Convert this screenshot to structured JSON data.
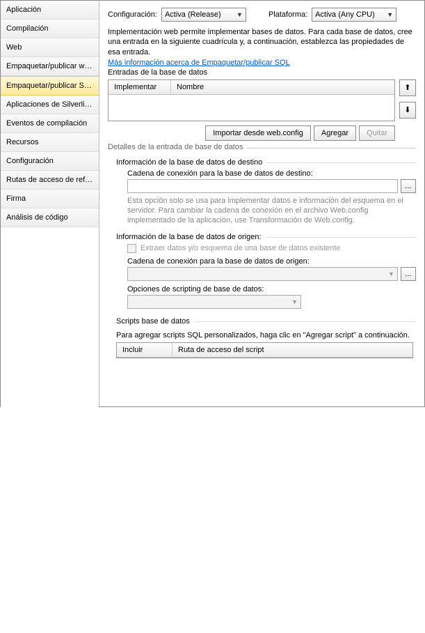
{
  "sidebar": {
    "items": [
      {
        "label": "Aplicación"
      },
      {
        "label": "Compilación"
      },
      {
        "label": "Web"
      },
      {
        "label": "Empaquetar/publicar web*"
      },
      {
        "label": "Empaquetar/publicar SQL"
      },
      {
        "label": "Aplicaciones de Silverlight"
      },
      {
        "label": "Eventos de compilación"
      },
      {
        "label": "Recursos"
      },
      {
        "label": "Configuración"
      },
      {
        "label": "Rutas de acceso de refe..."
      },
      {
        "label": "Firma"
      },
      {
        "label": "Análisis de código"
      }
    ],
    "active_index": 4
  },
  "top": {
    "config_label": "Configuración:",
    "config_value": "Activa (Release)",
    "platform_label": "Plataforma:",
    "platform_value": "Activa (Any CPU)"
  },
  "desc": {
    "text": "Implementación web permite implementar bases de datos. Para cada base de datos, cree una entrada en la siguiente cuadrícula y, a continuación, establezca las propiedades de esa entrada.",
    "link": "Más información acerca de Empaquetar/publicar SQL",
    "entries_label": "Entradas de la base de datos"
  },
  "grid": {
    "col_implement": "Implementar",
    "col_name": "Nombre"
  },
  "buttons": {
    "import": "Importar desde web.config",
    "add": "Agregar",
    "remove": "Quitar",
    "browse": "..."
  },
  "details": {
    "legend": "Detalles de la entrada de base de datos",
    "dest_info": "Información de la base de datos de destino",
    "dest_conn_label": "Cadena de conexión para la base de datos de destino:",
    "dest_hint": "Esta opción solo se usa para implementar datos e información del esquema en el servidor. Para cambiar la cadena de conexión en el archivo Web.config implementado de la aplicación, use Transformación de Web.config.",
    "src_info": "Información de la base de datos de origen:",
    "extract_label": "Extraer datos y/o esquema de una base de datos existente",
    "src_conn_label": "Cadena de conexión para la base de datos de origen:",
    "script_opts_label": "Opciones de scripting de base de datos:",
    "scripts_legend": "Scripts base de datos",
    "scripts_hint": "Para agregar scripts SQL personalizados, haga clic en \"Agregar script\" a continuación.",
    "col_include": "Incluir",
    "col_path": "Ruta de acceso del script"
  }
}
